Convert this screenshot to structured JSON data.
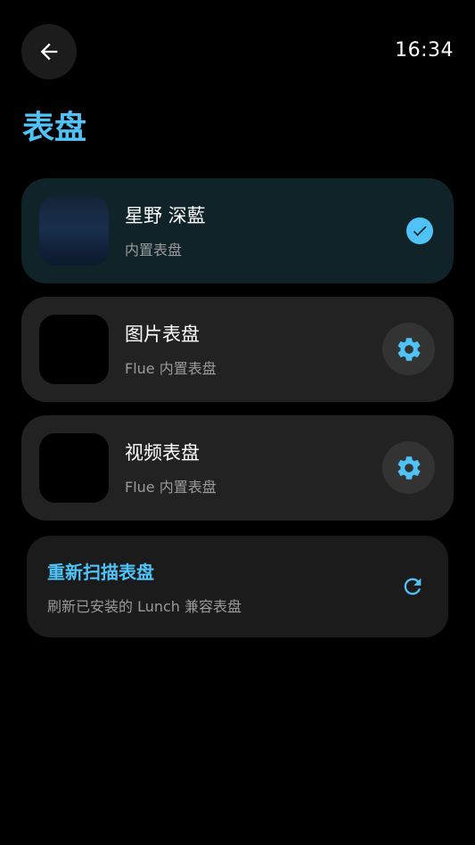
{
  "status": {
    "time": "16:34"
  },
  "header": {
    "title": "表盘"
  },
  "watchfaces": [
    {
      "name": "星野 深藍",
      "subtitle": "内置表盘",
      "selected": true,
      "action": "check-icon"
    },
    {
      "name": "图片表盘",
      "subtitle": "Flue 内置表盘",
      "selected": false,
      "action": "settings-icon"
    },
    {
      "name": "视频表盘",
      "subtitle": "Flue 内置表盘",
      "selected": false,
      "action": "settings-icon"
    }
  ],
  "rescan": {
    "title": "重新扫描表盘",
    "subtitle": "刷新已安装的 Lunch 兼容表盘"
  },
  "colors": {
    "accent": "#4fc3f7",
    "background": "#000000",
    "card": "#222222",
    "card_selected": "#0f2329"
  }
}
